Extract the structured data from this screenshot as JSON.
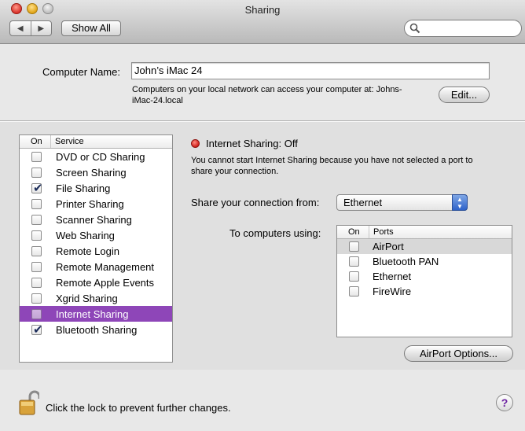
{
  "window": {
    "title": "Sharing"
  },
  "toolbar": {
    "back_glyph": "◀",
    "forward_glyph": "▶",
    "show_all_label": "Show All",
    "search_placeholder": ""
  },
  "computer": {
    "label": "Computer Name:",
    "name_value": "John’s iMac 24",
    "address_line1": "Computers on your local network can access your computer at: Johns-",
    "address_line2": "iMac-24.local",
    "edit_label": "Edit..."
  },
  "services": {
    "header_on": "On",
    "header_service": "Service",
    "items": [
      {
        "label": "DVD or CD Sharing",
        "checked": false
      },
      {
        "label": "Screen Sharing",
        "checked": false
      },
      {
        "label": "File Sharing",
        "checked": true
      },
      {
        "label": "Printer Sharing",
        "checked": false
      },
      {
        "label": "Scanner Sharing",
        "checked": false
      },
      {
        "label": "Web Sharing",
        "checked": false
      },
      {
        "label": "Remote Login",
        "checked": false
      },
      {
        "label": "Remote Management",
        "checked": false
      },
      {
        "label": "Remote Apple Events",
        "checked": false
      },
      {
        "label": "Xgrid Sharing",
        "checked": false
      },
      {
        "label": "Internet Sharing",
        "checked": false,
        "selected": true
      },
      {
        "label": "Bluetooth Sharing",
        "checked": true
      }
    ]
  },
  "internet_sharing": {
    "status_title": "Internet Sharing: Off",
    "status_color": "#d01f1a",
    "message_line1": "You cannot start Internet Sharing because you have not selected a port to",
    "message_line2": "share your connection.",
    "share_from_label": "Share your connection from:",
    "share_from_value": "Ethernet",
    "to_computers_label": "To computers using:",
    "ports_header_on": "On",
    "ports_header_ports": "Ports",
    "ports": [
      {
        "label": "AirPort",
        "checked": false
      },
      {
        "label": "Bluetooth PAN",
        "checked": false
      },
      {
        "label": "Ethernet",
        "checked": false
      },
      {
        "label": "FireWire",
        "checked": false
      }
    ],
    "airport_options_label": "AirPort Options..."
  },
  "footer": {
    "lock_text": "Click the lock to prevent further changes.",
    "help_glyph": "?"
  },
  "colors": {
    "selection": "#8e46b8"
  }
}
